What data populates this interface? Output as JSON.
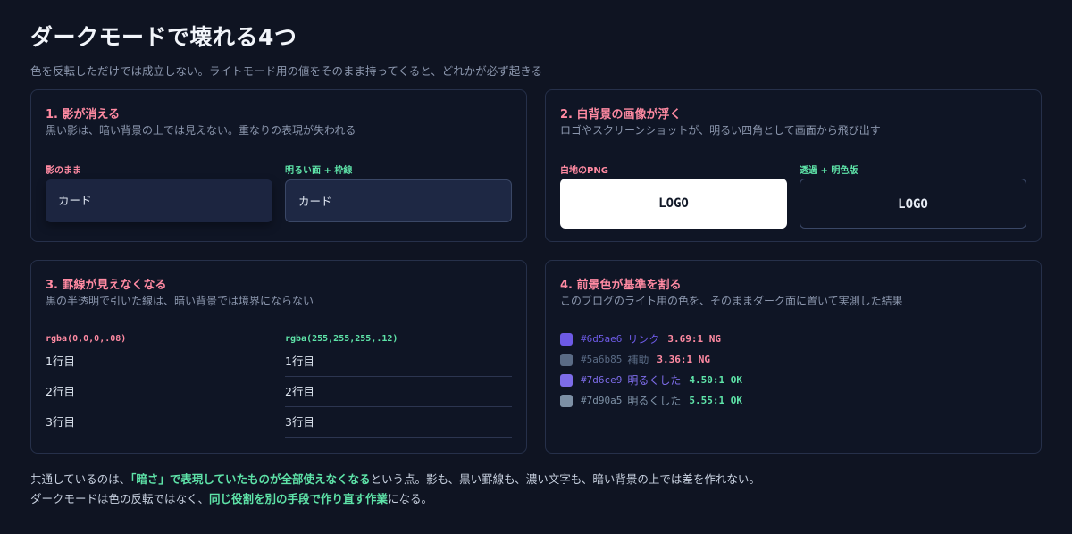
{
  "header": {
    "title": "ダークモードで壊れる4つ",
    "subtitle": "色を反転しただけでは成立しない。ライトモード用の値をそのまま持ってくると、どれかが必ず起きる"
  },
  "panels": [
    {
      "title": "1. 影が消える",
      "desc": "黒い影は、暗い背景の上では見えない。重なりの表現が失われる",
      "left_label": "影のまま",
      "right_label": "明るい面 + 枠線",
      "left_card": "カード",
      "right_card": "カード"
    },
    {
      "title": "2. 白背景の画像が浮く",
      "desc": "ロゴやスクリーンショットが、明るい四角として画面から飛び出す",
      "left_label": "白地のPNG",
      "right_label": "透過 + 明色版",
      "left_logo": "LOGO",
      "right_logo": "LOGO"
    },
    {
      "title": "3. 罫線が見えなくなる",
      "desc": "黒の半透明で引いた線は、暗い背景では境界にならない",
      "left_label": "rgba(0,0,0,.08)",
      "right_label": "rgba(255,255,255,.12)",
      "rows": [
        "1行目",
        "2行目",
        "3行目"
      ]
    },
    {
      "title": "4. 前景色が基準を割る",
      "desc": "このブログのライト用の色を、そのままダーク面に置いて実測した結果",
      "colors": [
        {
          "hex": "#6d5ae6",
          "name": "リンク",
          "ratio": "3.69:1 NG",
          "ratio_color": "#ff8aa2"
        },
        {
          "hex": "#5a6b85",
          "name": "補助",
          "ratio": "3.36:1 NG",
          "ratio_color": "#ff8aa2"
        },
        {
          "hex": "#7d6ce9",
          "name": "明るくした",
          "ratio": "4.50:1 OK",
          "ratio_color": "#5ee3a8"
        },
        {
          "hex": "#7d90a5",
          "name": "明るくした",
          "ratio": "5.55:1 OK",
          "ratio_color": "#5ee3a8"
        }
      ]
    }
  ],
  "footer": {
    "line1_a": "共通しているのは、",
    "line1_hl": "「暗さ」で表現していたものが全部使えなくなる",
    "line1_b": "という点。影も、黒い罫線も、濃い文字も、暗い背景の上では差を作れない。",
    "line2_a": "ダークモードは色の反転ではなく、",
    "line2_hl": "同じ役割を別の手段で作り直す作業",
    "line2_b": "になる。"
  }
}
